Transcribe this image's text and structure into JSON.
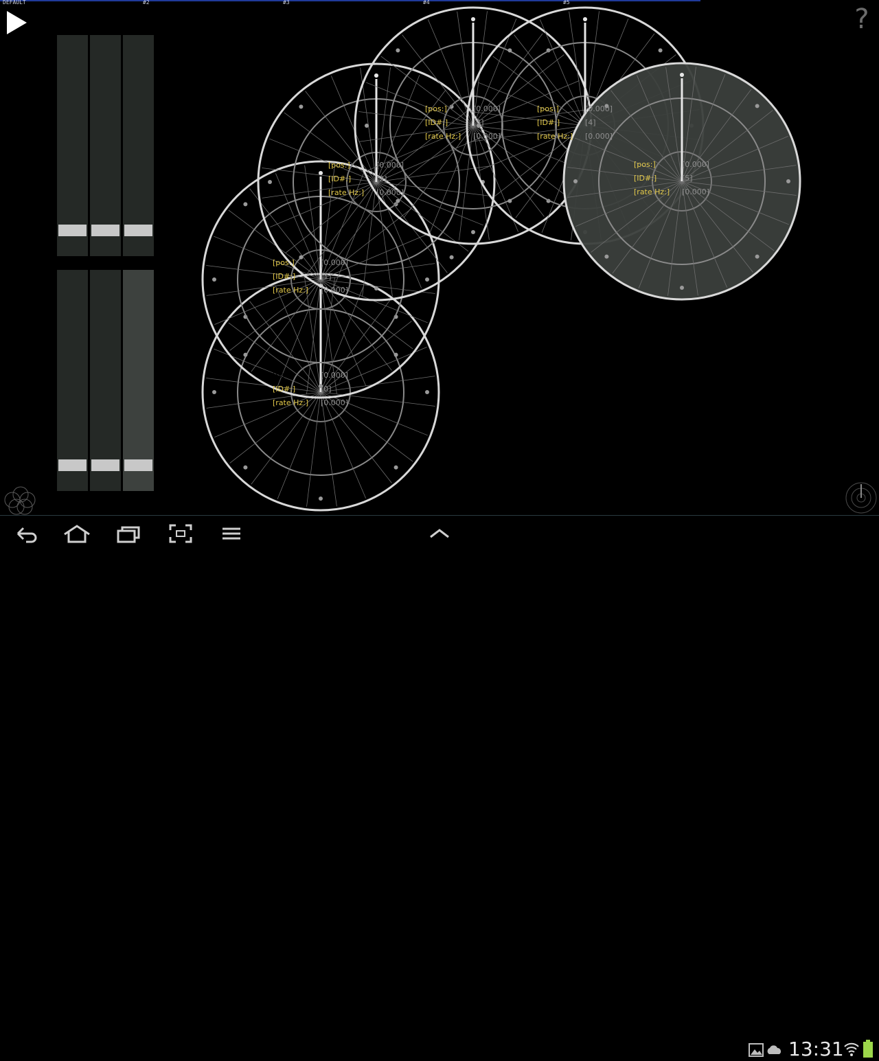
{
  "topbar": {
    "tabs": [
      "DEFAULT",
      "#2",
      "#3",
      "#4",
      "#5"
    ]
  },
  "controls": {
    "play_icon": "play-icon",
    "help_glyph": "?",
    "sliders_top": [
      {
        "name": "slider-top-1",
        "level": 0.07
      },
      {
        "name": "slider-top-2",
        "level": 0.07
      },
      {
        "name": "slider-top-3",
        "level": 0.07
      }
    ],
    "sliders_bottom": [
      {
        "name": "slider-bottom-1",
        "level": 0.07
      },
      {
        "name": "slider-bottom-2",
        "level": 0.07
      },
      {
        "name": "slider-bottom-3",
        "level": 0.07
      }
    ]
  },
  "wheels": [
    {
      "id": "0",
      "pos_label": "[pos:]",
      "pos_value": "[0.000]",
      "id_label": "[ID#:]",
      "id_value": "[0]",
      "rate_label": "[rate Hz:]",
      "rate_value": "[0.000]"
    },
    {
      "id": "1",
      "pos_label": "[pos:]",
      "pos_value": "[0.000]",
      "id_label": "[ID#:]",
      "id_value": "[1]",
      "rate_label": "[rate Hz:]",
      "rate_value": "[0.000]"
    },
    {
      "id": "2",
      "pos_label": "[pos:]",
      "pos_value": "[0.000]",
      "id_label": "[ID#:]",
      "id_value": "[2]",
      "rate_label": "[rate Hz:]",
      "rate_value": "[0.000]"
    },
    {
      "id": "3",
      "pos_label": "[pos:]",
      "pos_value": "[0.000]",
      "id_label": "[ID#:]",
      "id_value": "[3]",
      "rate_label": "[rate Hz:]",
      "rate_value": "[0.000]"
    },
    {
      "id": "4",
      "pos_label": "[pos:]",
      "pos_value": "[0.000]",
      "id_label": "[ID#:]",
      "id_value": "[4]",
      "rate_label": "[rate Hz:]",
      "rate_value": "[0.000]"
    },
    {
      "id": "5",
      "pos_label": "[pos:]",
      "pos_value": "[0.000]",
      "id_label": "[ID#:]",
      "id_value": "[5]",
      "rate_label": "[rate Hz:]",
      "rate_value": "[0.000]"
    }
  ],
  "navbar": {
    "clock": "13:31",
    "icons": [
      "back-icon",
      "home-icon",
      "recent-apps-icon",
      "screenshot-icon",
      "menu-icon",
      "chevron-up-icon",
      "gallery-icon",
      "cloud-icon",
      "wifi-icon",
      "battery-icon"
    ]
  },
  "colors": {
    "background": "#000000",
    "label_key": "#e3c94a",
    "label_value": "#8f8f8f",
    "wheel_stroke": "#d8d8d8",
    "selected_wheel_fill": "#3b3f3c",
    "slider_knob": "#c8c8c8"
  }
}
